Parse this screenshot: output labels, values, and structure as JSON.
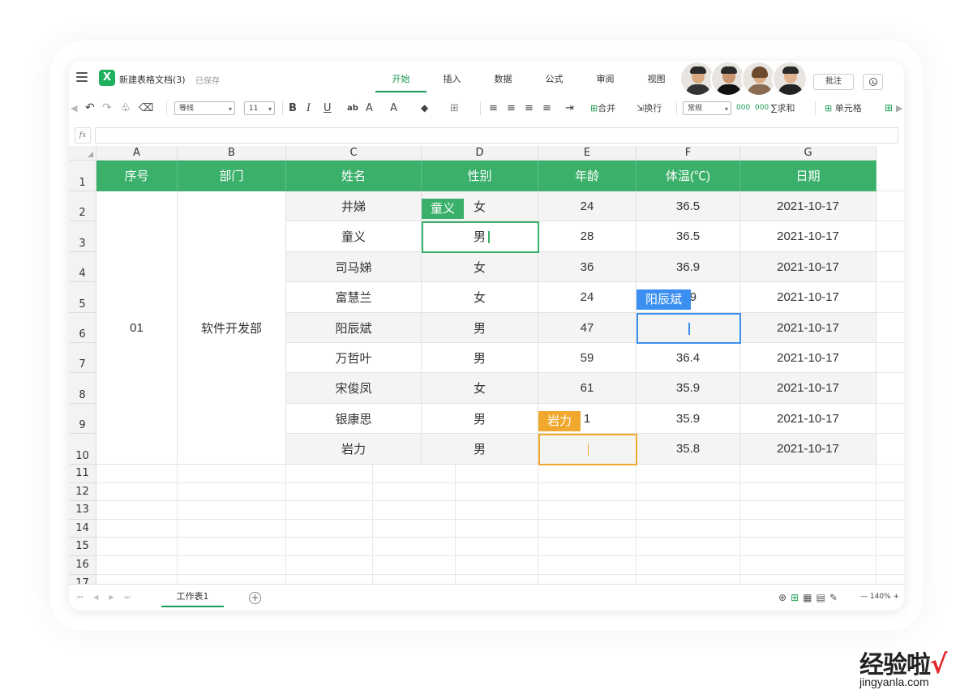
{
  "app": {
    "doc_title": "新建表格文档(3)",
    "saved_status": "已保存",
    "tabs": [
      "开始",
      "插入",
      "数据",
      "公式",
      "审阅",
      "视图"
    ],
    "active_tab": "开始",
    "annotate_button": "批注",
    "accent_color": "#1a9a52"
  },
  "toolbar": {
    "font_name": "等线",
    "font_size": "11",
    "bold": "B",
    "italic": "I",
    "underline": "U",
    "strike": "ab",
    "superscript": "A",
    "font_color": "A",
    "merge": "合并",
    "wrap": "换行",
    "number_format": "常规",
    "sum": "求和",
    "cell": "单元格"
  },
  "formula_bar": {
    "fx_label": "fx",
    "value": ""
  },
  "columns": [
    "A",
    "B",
    "C",
    "D",
    "E",
    "F",
    "G"
  ],
  "row_numbers": [
    "1",
    "2",
    "3",
    "4",
    "5",
    "6",
    "7",
    "8",
    "9",
    "10",
    "11",
    "12",
    "13",
    "14",
    "15",
    "16",
    "17"
  ],
  "table": {
    "headers": [
      "序号",
      "部门",
      "姓名",
      "性别",
      "年龄",
      "体温(℃)",
      "日期"
    ],
    "merged_seq": "01",
    "merged_dept": "软件开发部",
    "rows": [
      {
        "name": "井娣",
        "gender": "女",
        "age": "24",
        "temp": "36.5",
        "date": "2021-10-17"
      },
      {
        "name": "童义",
        "gender": "男",
        "age": "28",
        "temp": "36.5",
        "date": "2021-10-17"
      },
      {
        "name": "司马娣",
        "gender": "女",
        "age": "36",
        "temp": "36.9",
        "date": "2021-10-17"
      },
      {
        "name": "富慧兰",
        "gender": "女",
        "age": "24",
        "temp": "6.9",
        "date": "2021-10-17"
      },
      {
        "name": "阳辰斌",
        "gender": "男",
        "age": "47",
        "temp": "",
        "date": "2021-10-17"
      },
      {
        "name": "万哲叶",
        "gender": "男",
        "age": "59",
        "temp": "36.4",
        "date": "2021-10-17"
      },
      {
        "name": "宋俊凤",
        "gender": "女",
        "age": "61",
        "temp": "35.9",
        "date": "2021-10-17"
      },
      {
        "name": "银康思",
        "gender": "男",
        "age": "1",
        "temp": "35.9",
        "date": "2021-10-17"
      },
      {
        "name": "岩力",
        "gender": "男",
        "age": "",
        "temp": "35.8",
        "date": "2021-10-17"
      }
    ]
  },
  "collaborators": [
    {
      "name": "童义",
      "color": "#3bb06a"
    },
    {
      "name": "阳辰斌",
      "color": "#3a8ff0"
    },
    {
      "name": "岩力",
      "color": "#f0a92e"
    }
  ],
  "sheet_tabs": [
    "工作表1"
  ],
  "zoom_level": "140%",
  "watermark": {
    "cn": "经验啦",
    "en": "jingyanla.com"
  }
}
